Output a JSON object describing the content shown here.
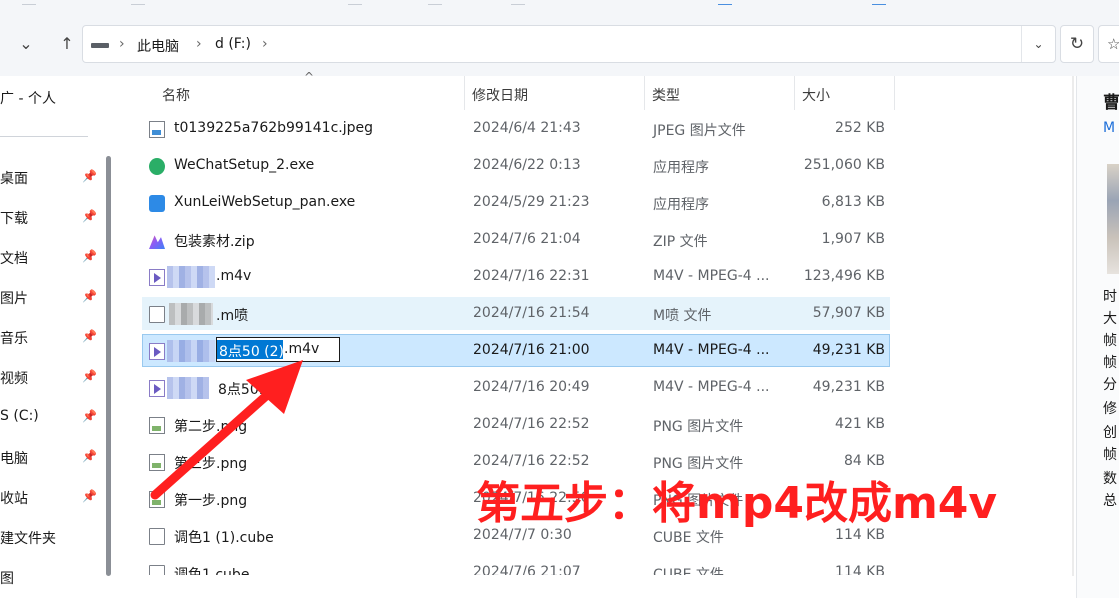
{
  "address_bar": {
    "breadcrumbs": [
      "此电脑",
      "d (F:)"
    ],
    "separator": "›"
  },
  "toolbar": {
    "refresh_icon": "refresh-icon",
    "dropdown_icon": "chevron-down-icon"
  },
  "nav": {
    "title": "广 - 个人",
    "items": [
      {
        "label": "桌面",
        "pinned": true
      },
      {
        "label": "下载",
        "pinned": true
      },
      {
        "label": "文档",
        "pinned": true
      },
      {
        "label": "图片",
        "pinned": true
      },
      {
        "label": "音乐",
        "pinned": true
      },
      {
        "label": "视频",
        "pinned": true
      },
      {
        "label": "OS (C:)",
        "pinned": true
      },
      {
        "label": "此电脑",
        "pinned": true
      },
      {
        "label": "回收站",
        "pinned": true
      },
      {
        "label": "新建文件夹",
        "pinned": false
      },
      {
        "label": "动图",
        "pinned": false
      }
    ],
    "visible_labels": [
      "桌面",
      "下载",
      "文档",
      "图片",
      "音乐",
      "视频",
      "S (C:)",
      "电脑",
      "收站",
      "建文件夹",
      "图"
    ]
  },
  "columns": {
    "name": "名称",
    "date": "修改日期",
    "type": "类型",
    "size": "大小"
  },
  "files": [
    {
      "name": "t0139225a762b99141c.jpeg",
      "date": "2024/6/4 21:43",
      "type": "JPEG 图片文件",
      "size": "252 KB",
      "icon": "image-file-icon"
    },
    {
      "name": "WeChatSetup_2.exe",
      "date": "2024/6/22 0:13",
      "type": "应用程序",
      "size": "251,060 KB",
      "icon": "wechat-icon"
    },
    {
      "name": "XunLeiWebSetup_pan.exe",
      "date": "2024/5/29 21:23",
      "type": "应用程序",
      "size": "6,813 KB",
      "icon": "xunlei-icon"
    },
    {
      "name": "包装素材.zip",
      "date": "2024/7/6 21:04",
      "type": "ZIP 文件",
      "size": "1,907 KB",
      "icon": "zip-icon"
    },
    {
      "name": ".m4v",
      "date": "2024/7/16 22:31",
      "type": "M4V - MPEG-4 ...",
      "size": "123,496 KB",
      "icon": "video-file-icon"
    },
    {
      "name": ".m喷",
      "date": "2024/7/16 21:54",
      "type": "M喷 文件",
      "size": "57,907 KB",
      "icon": "document-icon"
    },
    {
      "name": "8点50 (2).m4v",
      "date": "2024/7/16 21:00",
      "type": "M4V - MPEG-4 ...",
      "size": "49,231 KB",
      "icon": "video-file-icon"
    },
    {
      "name": "8点50.m4v",
      "date": "2024/7/16 20:49",
      "type": "M4V - MPEG-4 ...",
      "size": "49,231 KB",
      "icon": "video-file-icon"
    },
    {
      "name": "第二步.png",
      "date": "2024/7/16 22:52",
      "type": "PNG 图片文件",
      "size": "421 KB",
      "icon": "png-file-icon"
    },
    {
      "name": "第三步.png",
      "date": "2024/7/16 22:52",
      "type": "PNG 图片文件",
      "size": "84 KB",
      "icon": "png-file-icon"
    },
    {
      "name": "第一步.png",
      "date": "2024/7/16 22:50",
      "type": "PNG 图片文件",
      "size": "",
      "icon": "png-file-icon"
    },
    {
      "name": "调色1 (1).cube",
      "date": "2024/7/7 0:30",
      "type": "CUBE 文件",
      "size": "114 KB",
      "icon": "document-icon"
    },
    {
      "name": "调色1.cube",
      "date": "2024/7/6 21:07",
      "type": "CUBE 文件",
      "size": "114 KB",
      "icon": "document-icon"
    }
  ],
  "rename_field": {
    "selected_text": "8点50 (2)",
    "extension": ".m4v"
  },
  "preview": {
    "title": "曹",
    "subtitle": "M",
    "props": [
      "时",
      "大",
      "帧",
      "帧",
      "分",
      "修",
      "创",
      "帧",
      "数",
      "总"
    ]
  },
  "annotation": {
    "text": "第五步：将mp4改成m4v",
    "color": "#ff1f1f"
  },
  "colors": {
    "selection": "#cce8ff",
    "selection_border": "#99c9ef",
    "hover": "#e5f3fb",
    "rename_highlight": "#0078d4"
  }
}
